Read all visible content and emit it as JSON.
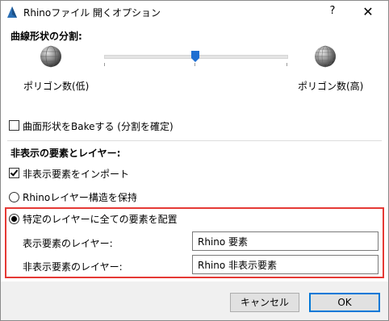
{
  "window": {
    "title": "Rhinoファイル 開くオプション",
    "help_label": "?",
    "close_label": "✕"
  },
  "curve_section": {
    "heading": "曲線形状の分割:",
    "low_label": "ポリゴン数(低)",
    "high_label": "ポリゴン数(高)",
    "slider_value": 0.5
  },
  "bake_option": {
    "label": "曲面形状をBakeする (分割を確定)",
    "checked": false
  },
  "hidden_section": {
    "heading": "非表示の要素とレイヤー:",
    "import_hidden": {
      "label": "非表示要素をインポート",
      "checked": true
    },
    "keep_layers": {
      "label": "Rhinoレイヤー構造を保持",
      "selected": false
    },
    "specific_layer": {
      "label": "特定のレイヤーに全ての要素を配置",
      "selected": true
    },
    "visible_layer": {
      "label": "表示要素のレイヤー:",
      "value": "Rhino 要素"
    },
    "hidden_layer": {
      "label": "非表示要素のレイヤー:",
      "value": "Rhino 非表示要素"
    }
  },
  "footer": {
    "cancel_label": "キャンセル",
    "ok_label": "OK"
  },
  "colors": {
    "highlight": "#e53935",
    "slider_thumb": "#1f6fd1",
    "default_button_border": "#0078d7"
  }
}
